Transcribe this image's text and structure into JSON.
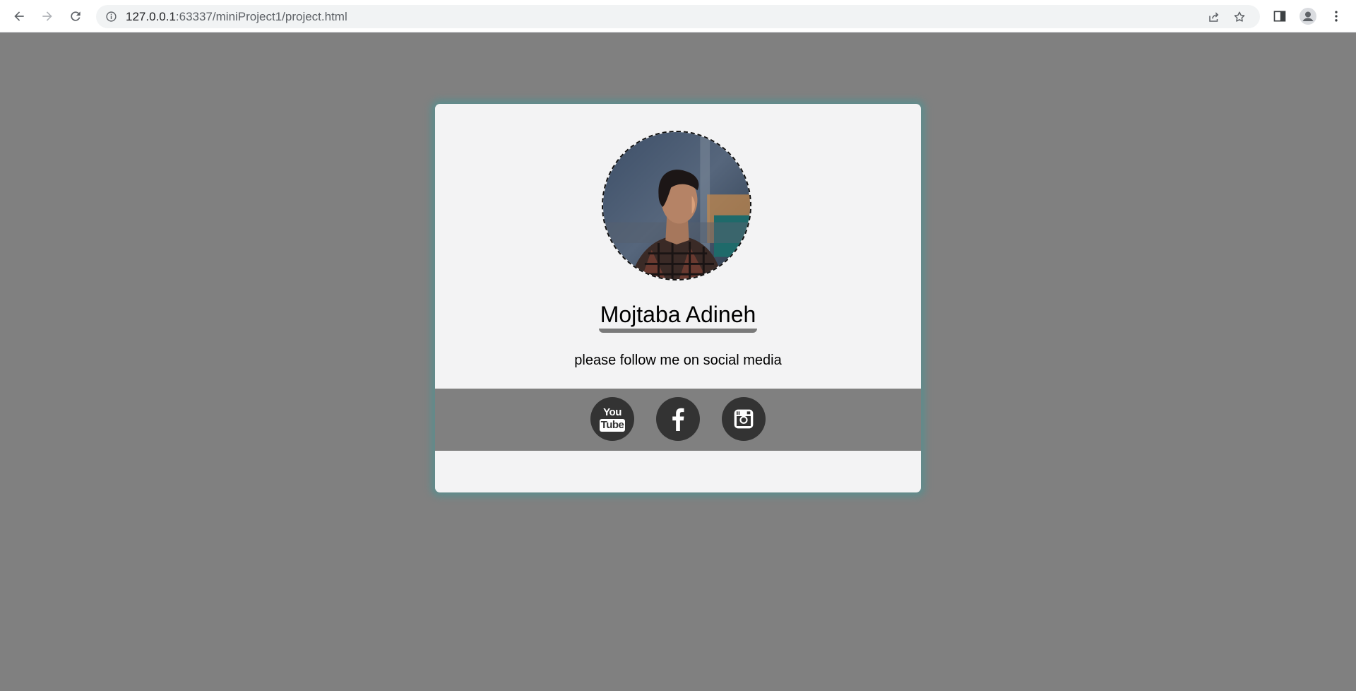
{
  "browser": {
    "url_host": "127.0.0.1",
    "url_rest": ":63337/miniProject1/project.html"
  },
  "profile": {
    "name": "Mojtaba Adineh",
    "tagline": "please follow me on social media",
    "photo": "profile-photo-man-plaid-shirt"
  },
  "social": [
    {
      "name": "youtube",
      "icon": "youtube-icon",
      "label_top": "You",
      "label_bottom": "Tube"
    },
    {
      "name": "facebook",
      "icon": "facebook-icon",
      "glyph": "f"
    },
    {
      "name": "instagram",
      "icon": "instagram-icon"
    }
  ],
  "colors": {
    "page_bg": "#808080",
    "card_bg": "#f3f3f4",
    "card_glow": "#5e8c8c",
    "social_bg": "#333333"
  }
}
